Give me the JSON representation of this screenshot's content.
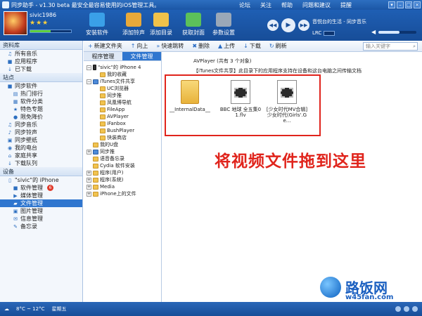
{
  "window": {
    "title": "同步助手 - v1.30 beta  最安全最容易使用的iOS管理工具。",
    "links": [
      "论坛",
      "关注",
      "帮助",
      "问题和建议",
      "提醒"
    ],
    "controls": [
      "▾",
      "–",
      "□",
      "×"
    ]
  },
  "header": {
    "username": "sivic1986",
    "stars": "★★★",
    "capacity_fraction": 0.5,
    "tools": [
      {
        "label": "安装软件",
        "color": "#3aa0e8"
      },
      {
        "label": "添加铃声",
        "color": "#e8a93a"
      },
      {
        "label": "添加目录",
        "color": "#f0c24a"
      },
      {
        "label": "获取封面",
        "color": "#5cc05a"
      },
      {
        "label": "参数设置",
        "color": "#9aa8b8"
      }
    ],
    "player": {
      "prev": "◀◀",
      "play": "▶",
      "next": "▶▶"
    },
    "song": "音悦台的生活 - 同步音乐",
    "lrc_label": "LRC",
    "volume_fraction": 0.55
  },
  "sidebar": {
    "library_title": "资料库",
    "library": [
      {
        "label": "所有音乐",
        "icon": "music-icon"
      },
      {
        "label": "应用程序",
        "icon": "app-icon"
      },
      {
        "label": "已下载",
        "icon": "download-icon"
      }
    ],
    "station_title": "站点",
    "station_head": "同步软件",
    "station": [
      {
        "label": "热门排行",
        "icon": "chart-icon"
      },
      {
        "label": "软件分类",
        "icon": "grid-icon"
      },
      {
        "label": "特色专题",
        "icon": "star-icon"
      },
      {
        "label": "限免降价",
        "icon": "tag-icon"
      }
    ],
    "station_more": [
      {
        "label": "同步音乐",
        "icon": "music-icon"
      },
      {
        "label": "同步铃声",
        "icon": "bell-icon"
      },
      {
        "label": "同步壁纸",
        "icon": "image-icon"
      },
      {
        "label": "我的电台",
        "icon": "radio-icon"
      },
      {
        "label": "家庭共享",
        "icon": "home-icon"
      },
      {
        "label": "下载队列",
        "icon": "download-icon"
      }
    ],
    "device_title": "设备",
    "device_name": "\"sivic\"的 iPhone",
    "device_items": [
      {
        "label": "软件管理",
        "icon": "app-icon",
        "badge": "6"
      },
      {
        "label": "媒体管理",
        "icon": "media-icon",
        "badge": ""
      },
      {
        "label": "文件管理",
        "icon": "folder-icon",
        "badge": ""
      },
      {
        "label": "图片管理",
        "icon": "image-icon",
        "badge": ""
      },
      {
        "label": "信息管理",
        "icon": "message-icon",
        "badge": ""
      },
      {
        "label": "备忘录",
        "icon": "note-icon",
        "badge": ""
      }
    ]
  },
  "actionbar": {
    "buttons": [
      {
        "label": "新建文件夹",
        "icon": "folder-plus-icon"
      },
      {
        "label": "向上",
        "icon": "up-folder-icon"
      },
      {
        "label": "快速跳转",
        "icon": "jump-icon"
      },
      {
        "label": "删除",
        "icon": "delete-icon"
      },
      {
        "label": "上传",
        "icon": "upload-icon"
      },
      {
        "label": "下载",
        "icon": "download-icon"
      },
      {
        "label": "刷新",
        "icon": "refresh-icon"
      }
    ],
    "search_placeholder": "输入关键字"
  },
  "tree": {
    "tabs": [
      "程序管理",
      "文件管理"
    ],
    "items": [
      {
        "label": "\"sivic\"的 iPhone 4",
        "depth": 0,
        "kind": "dev",
        "exp": "−"
      },
      {
        "label": "我的收藏",
        "depth": 1,
        "kind": "folder",
        "exp": ""
      },
      {
        "label": "iTunes文件共享",
        "depth": 0,
        "kind": "app",
        "exp": "−"
      },
      {
        "label": "UC浏览器",
        "depth": 1,
        "kind": "folder",
        "exp": ""
      },
      {
        "label": "同步推",
        "depth": 1,
        "kind": "folder",
        "exp": ""
      },
      {
        "label": "凤凰博导航",
        "depth": 1,
        "kind": "folder",
        "exp": ""
      },
      {
        "label": "FileApp",
        "depth": 1,
        "kind": "folder",
        "exp": ""
      },
      {
        "label": "AVPlayer",
        "depth": 1,
        "kind": "folder",
        "exp": ""
      },
      {
        "label": "iFanbox",
        "depth": 1,
        "kind": "folder",
        "exp": ""
      },
      {
        "label": "BushPlayer",
        "depth": 1,
        "kind": "folder",
        "exp": ""
      },
      {
        "label": "快装商店",
        "depth": 1,
        "kind": "folder",
        "exp": ""
      },
      {
        "label": "我的U盘",
        "depth": 0,
        "kind": "folder",
        "exp": ""
      },
      {
        "label": "同步推",
        "depth": 0,
        "kind": "app",
        "exp": "+"
      },
      {
        "label": "语音备忘录",
        "depth": 0,
        "kind": "folder",
        "exp": ""
      },
      {
        "label": "Cydia 软件安装",
        "depth": 0,
        "kind": "folder",
        "exp": ""
      },
      {
        "label": "程序(用户)",
        "depth": 0,
        "kind": "folder",
        "exp": "+"
      },
      {
        "label": "程序(系统)",
        "depth": 0,
        "kind": "folder",
        "exp": "+"
      },
      {
        "label": "Media",
        "depth": 0,
        "kind": "folder",
        "exp": "+"
      },
      {
        "label": "iPhone上的文件",
        "depth": 0,
        "kind": "folder",
        "exp": "+"
      }
    ]
  },
  "files": {
    "path": "AVPlayer (共有 3 个对象)",
    "info": "【iTunes文件共享】此目录下的应用程序支持在设备和这台电脑之间传输文档",
    "items": [
      {
        "name": "__InternalData__",
        "type": "folder"
      },
      {
        "name": "BBC 地球 全五集01.flv",
        "type": "video"
      },
      {
        "name": "[少女时代MV合辑] 少女时代(Girls'.Ge...",
        "type": "video"
      }
    ],
    "caption": "将视频文件拖到这里"
  },
  "watermark": {
    "name": "路饭网",
    "url": "w45fan.com"
  },
  "statusbar": {
    "weather": "8°C ~ 12°C",
    "day": "星期五"
  }
}
